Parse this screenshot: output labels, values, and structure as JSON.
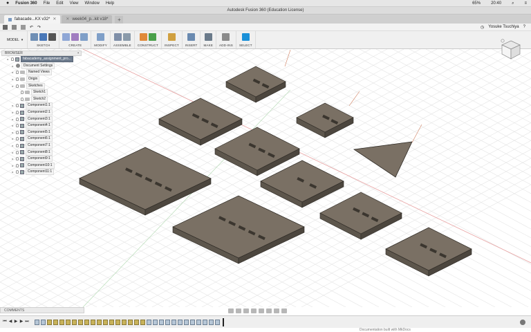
{
  "mac_menu": {
    "apple": "",
    "app_name": "Fusion 360",
    "items": [
      "File",
      "Edit",
      "View",
      "Window",
      "Help"
    ],
    "status": {
      "battery": "65%",
      "time": "20:40"
    }
  },
  "window_title": "Autodesk Fusion 360 (Education License)",
  "tabs": [
    {
      "label": "fabacade...KX v32*",
      "active": true
    },
    {
      "label": "week04_p...kit v18*",
      "active": false
    }
  ],
  "user": {
    "name": "Yosuke Tsuchiya",
    "help": "?"
  },
  "ribbon": {
    "workspace": "MODEL",
    "groups": [
      {
        "label": "SKETCH",
        "colors": [
          "#6f8fb5",
          "#4a78b8",
          "#555555"
        ]
      },
      {
        "label": "CREATE",
        "colors": [
          "#8fa7d6",
          "#a07cc0",
          "#7f9fc8"
        ]
      },
      {
        "label": "MODIFY",
        "colors": [
          "#7f9fc8"
        ]
      },
      {
        "label": "ASSEMBLE",
        "colors": [
          "#7f8fa8",
          "#8a9aaa"
        ]
      },
      {
        "label": "CONSTRUCT",
        "colors": [
          "#e08a3a",
          "#4aa04a"
        ]
      },
      {
        "label": "INSPECT",
        "colors": [
          "#d0a040"
        ]
      },
      {
        "label": "INSERT",
        "colors": [
          "#6a8ab0"
        ]
      },
      {
        "label": "MAKE",
        "colors": [
          "#6a7a8a"
        ]
      },
      {
        "label": "ADD-INS",
        "colors": [
          "#8a8a8a"
        ]
      },
      {
        "label": "SELECT",
        "colors": [
          "#1a90d8"
        ]
      }
    ]
  },
  "browser": {
    "title": "BROWSER",
    "rows": [
      {
        "label": "fabacademy_assignment_pro...",
        "indent": 1,
        "kind": "root"
      },
      {
        "label": "Document Settings",
        "indent": 2,
        "kind": "gear"
      },
      {
        "label": "Named Views",
        "indent": 2,
        "kind": "folder"
      },
      {
        "label": "Origin",
        "indent": 2,
        "kind": "folder"
      },
      {
        "label": "Sketches",
        "indent": 2,
        "kind": "folder"
      },
      {
        "label": "Sketch1",
        "indent": 3,
        "kind": "sketch"
      },
      {
        "label": "Sketch2",
        "indent": 3,
        "kind": "sketch"
      },
      {
        "label": "Component1:1",
        "indent": 2,
        "kind": "comp"
      },
      {
        "label": "Component2:1",
        "indent": 2,
        "kind": "comp"
      },
      {
        "label": "Component3:1",
        "indent": 2,
        "kind": "comp"
      },
      {
        "label": "Component4:1",
        "indent": 2,
        "kind": "comp"
      },
      {
        "label": "Component5:1",
        "indent": 2,
        "kind": "comp"
      },
      {
        "label": "Component6:1",
        "indent": 2,
        "kind": "comp"
      },
      {
        "label": "Component7:1",
        "indent": 2,
        "kind": "comp"
      },
      {
        "label": "Component8:1",
        "indent": 2,
        "kind": "comp"
      },
      {
        "label": "Component9:1",
        "indent": 2,
        "kind": "comp"
      },
      {
        "label": "Component10:1",
        "indent": 2,
        "kind": "comp"
      },
      {
        "label": "Component11:1",
        "indent": 2,
        "kind": "comp"
      }
    ]
  },
  "comments_label": "COMMENTS",
  "timeline": {
    "steps": 30
  },
  "bottom_notice": "Documentation built with MkDocs"
}
